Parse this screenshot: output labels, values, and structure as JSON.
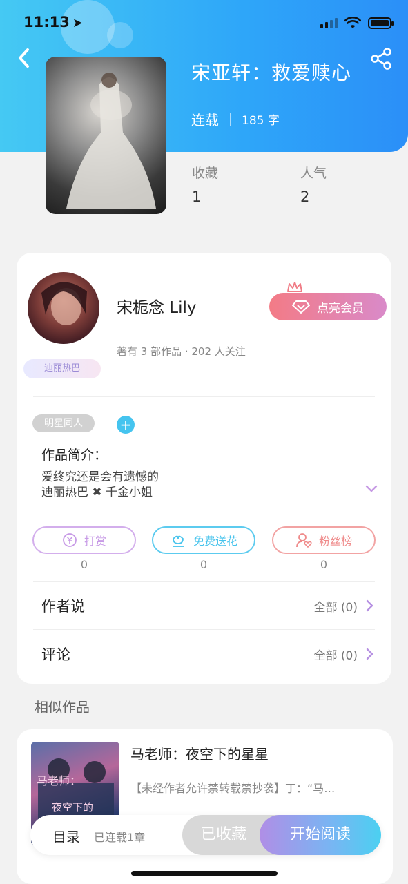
{
  "status_bar": {
    "time": "11:13"
  },
  "book": {
    "title": "宋亚轩：救爱赎心",
    "status": "连载",
    "word_count": "185 字",
    "stats": [
      {
        "label": "收藏",
        "value": "1"
      },
      {
        "label": "人气",
        "value": "2"
      }
    ]
  },
  "author": {
    "name": "宋栀念 Lily",
    "tag": "迪丽热巴",
    "meta": "著有 3 部作品 · 202 人关注",
    "vip_label": "点亮会员"
  },
  "work": {
    "category_tag": "明星同人",
    "intro_label": "作品简介：",
    "intro_lines": [
      "爱终究还是会有遗憾的",
      "迪丽热巴 ✖ 千金小姐"
    ]
  },
  "actions": [
    {
      "label": "打赏",
      "count": "0",
      "color": "#c79ae6"
    },
    {
      "label": "免费送花",
      "count": "0",
      "color": "#46c3ec"
    },
    {
      "label": "粉丝榜",
      "count": "0",
      "color": "#ef8a8a"
    }
  ],
  "sections": [
    {
      "title": "作者说",
      "right": "全部 (0)"
    },
    {
      "title": "评论",
      "right": "全部 (0)"
    }
  ],
  "similar": {
    "header": "相似作品",
    "items": [
      {
        "title": "马老师：夜空下的星星",
        "desc": "【未经作者允许禁转载禁抄袭】丁：“马…"
      }
    ]
  },
  "bottom_bar": {
    "toc_label": "目录",
    "serial_label": "已连载1章",
    "collected_label": "已收藏",
    "read_label": "开始阅读"
  }
}
